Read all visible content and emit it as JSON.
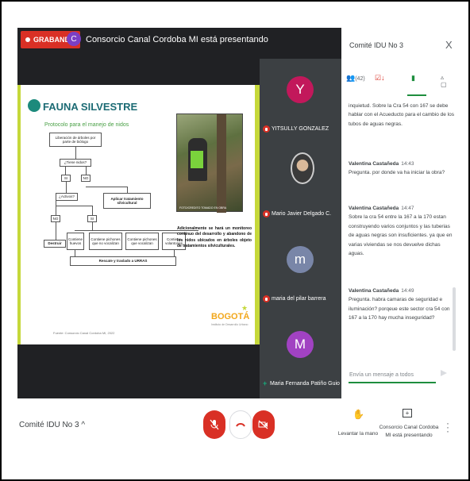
{
  "meet": {
    "recording_label": "GRABANDO",
    "presenter_initial": "C",
    "presenting_text": "Consorcio Canal Cordoba MI está presentando"
  },
  "slide": {
    "title": "FAUNA SILVESTRE",
    "subtitle": "Protocolo para el manejo de nidos",
    "flowchart": [
      "Liberación de árboles por parte de biólogo",
      "¿Tiene nidos?",
      "SI",
      "NO",
      "¿Activos?",
      "Aplicar tratamiento silvicultural",
      "NO",
      "SI",
      "Destruir",
      "Contiene huevos",
      "Contiene pichones que no vocalizan",
      "Contiene pichones que vocalizan",
      "Contiene volantones",
      "Rescate y traslado a URRAS"
    ],
    "photo_caption": "FOTO/CREDITO TOMADO EN OBRA",
    "description": "Adicionalmente se hará un monitoreo continuo del desarrollo y abandono de los nidos ubicados en árboles objeto de tratamientos silviculturales.",
    "logo_text": "BOGOTÁ",
    "logo_sub": "Instituto de Desarrollo Urbano",
    "footer": "Fuente: Consorcio Canal Cordoba MI, 2022"
  },
  "participants": [
    {
      "initial": "Y",
      "name": "YITSULLY GONZALEZ",
      "color": "#c2185b"
    },
    {
      "initial": "",
      "name": "Mario Javier Delgado C.",
      "color": "#3c4043"
    },
    {
      "initial": "m",
      "name": "maria del pilar barrera",
      "color": "#7986a8"
    },
    {
      "initial": "M",
      "name": "Maria Fernanda Patiño Guio",
      "color": "#a142c2"
    }
  ],
  "panel": {
    "title": "Comité IDU No 3",
    "tab_people_count": "(42)",
    "messages": [
      {
        "author": "",
        "time": "",
        "text": "inquietud. Sobre la Cra 54 con 167 se debe hablar con el Acueducto para el cambio de los tubos de aguas negras."
      },
      {
        "author": "Valentina Castañeda",
        "time": "14:43",
        "text": "Pregunta. por donde va ha iniciar la obra?"
      },
      {
        "author": "Valentina Castañeda",
        "time": "14:47",
        "text": "Sobre la cra 54 entre la 167 a la 170 estan construyendo varios conjuntos y las tuberias de aguas negras son insuficientes. ya que en varias viviendas se nos devuelve dichas aguas."
      },
      {
        "author": "Valentina Castañeda",
        "time": "14:49",
        "text": "Pregunta. habra camaras de seguridad e iluminación? porqeue este sector cra 54 con 167 a la 170 hay mucha inseguridad?"
      }
    ],
    "input_placeholder": "Envía un mensaje a todos"
  },
  "controls": {
    "meeting_title": "Comité IDU No 3 ^",
    "raise_hand_label": "Levantar la mano",
    "presenting_label": "Consorcio Canal Cordoba MI está presentando"
  }
}
